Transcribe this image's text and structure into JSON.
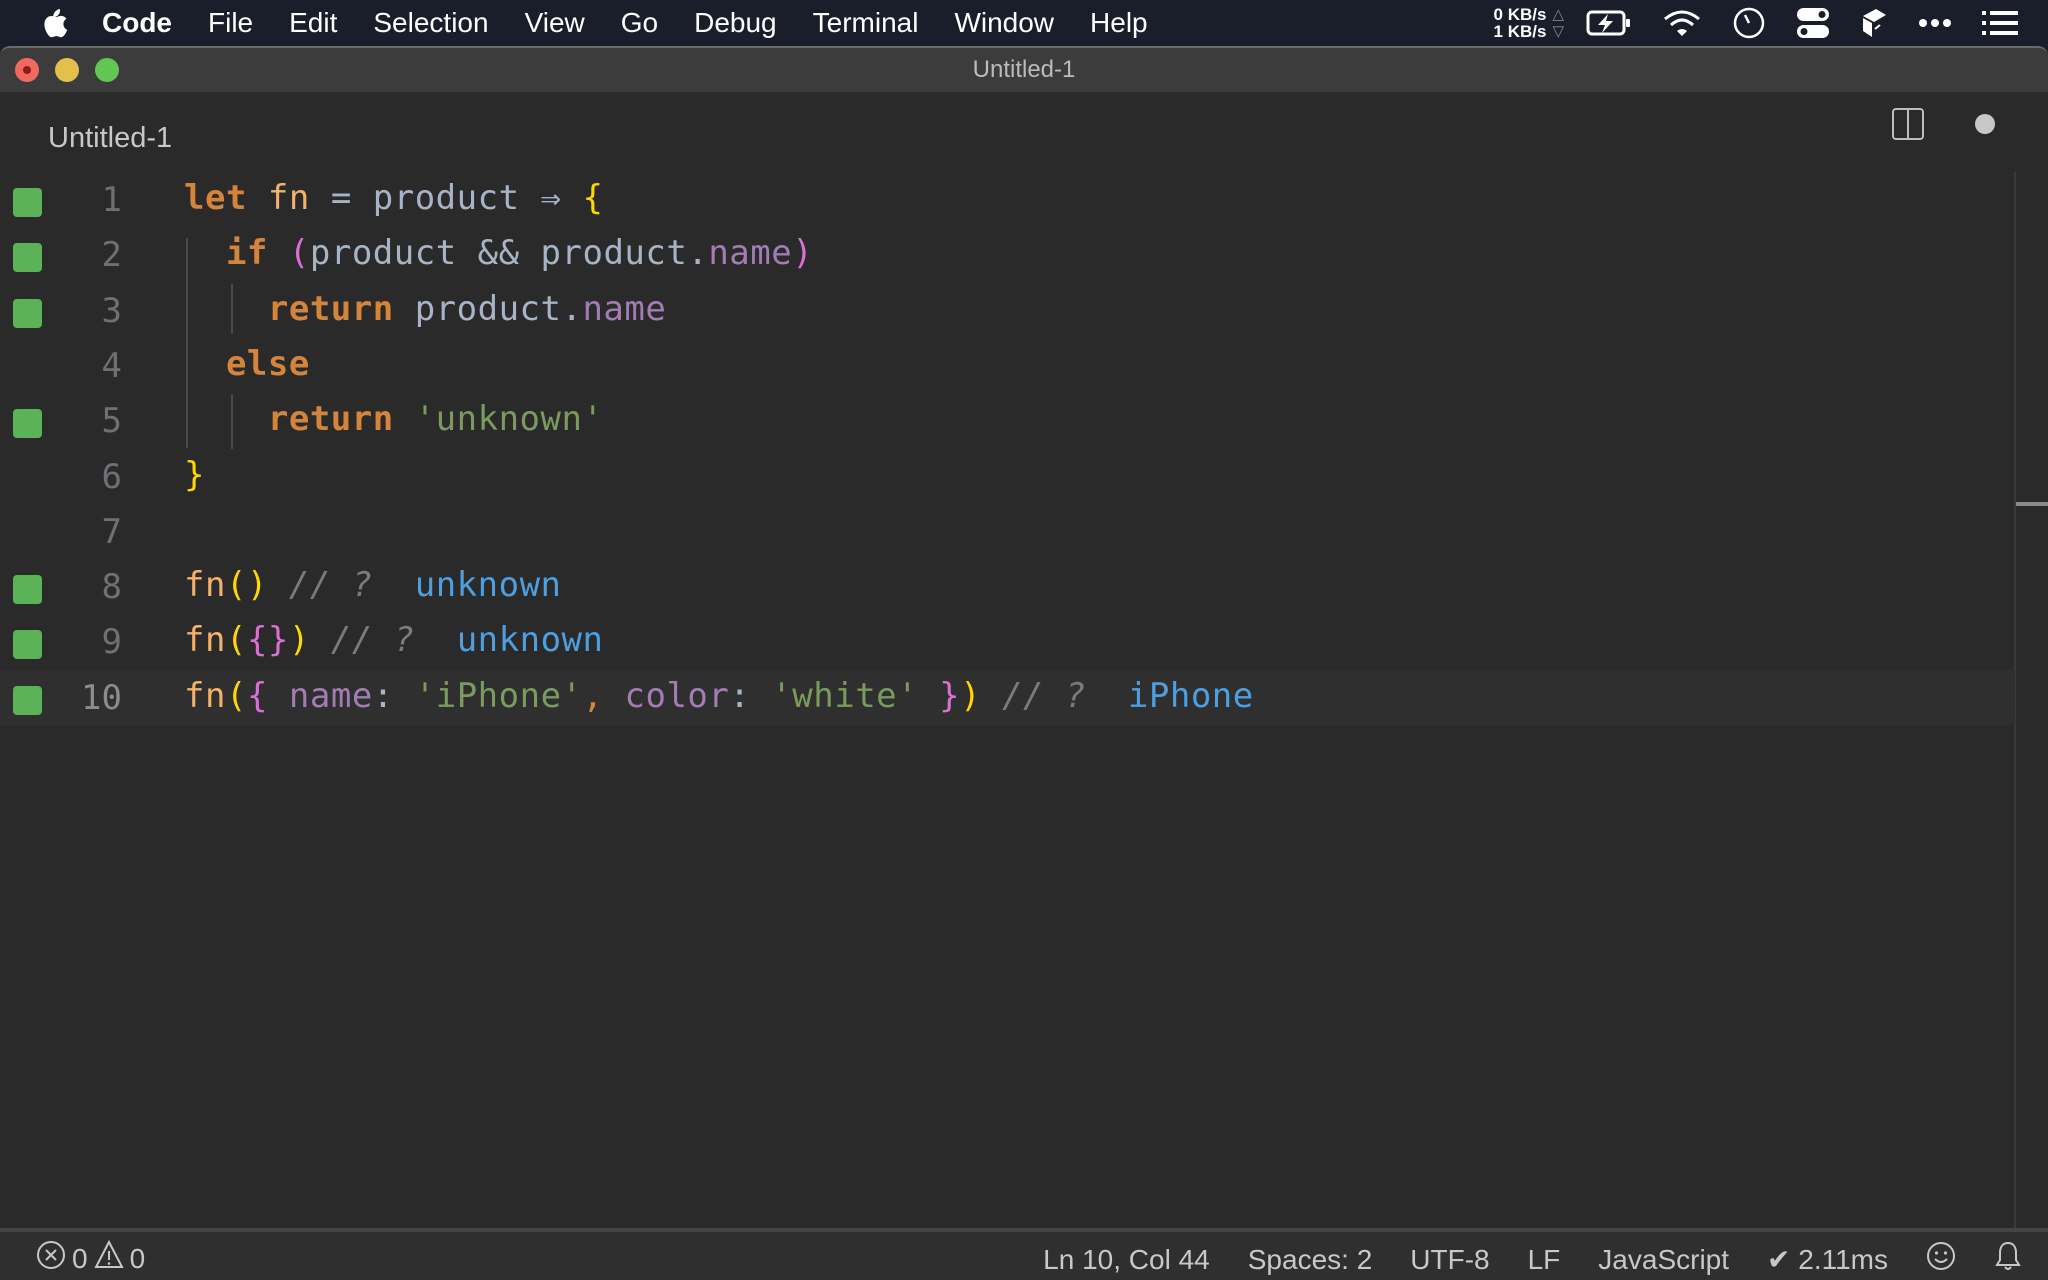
{
  "menubar": {
    "app_name": "Code",
    "items": [
      "File",
      "Edit",
      "Selection",
      "View",
      "Go",
      "Debug",
      "Terminal",
      "Window",
      "Help"
    ],
    "net_up": "0 KB/s",
    "net_down": "1 KB/s",
    "tray_icons": [
      "battery-charging-icon",
      "wifi-icon",
      "clock-icon",
      "control-center-toggles-icon",
      "box-app-icon",
      "more-dots-icon",
      "list-menu-icon"
    ]
  },
  "window": {
    "title": "Untitled-1"
  },
  "tabbar": {
    "active_tab": "Untitled-1",
    "split_editor": "split-editor-icon",
    "unsaved_indicator": "unsaved-dot-icon"
  },
  "editor": {
    "lines": [
      {
        "num": "1",
        "marked": true,
        "tokens": [
          [
            "kw",
            "let"
          ],
          [
            "id",
            " "
          ],
          [
            "fnname",
            "fn"
          ],
          [
            "id",
            " = product ⇒ "
          ],
          [
            "brace-y",
            "{"
          ]
        ]
      },
      {
        "num": "2",
        "marked": true,
        "tokens": [
          [
            "id",
            "  "
          ],
          [
            "kw",
            "if"
          ],
          [
            "id",
            " "
          ],
          [
            "brace-p",
            "("
          ],
          [
            "id",
            "product && product."
          ],
          [
            "prop",
            "name"
          ],
          [
            "brace-p",
            ")"
          ]
        ]
      },
      {
        "num": "3",
        "marked": true,
        "tokens": [
          [
            "id",
            "    "
          ],
          [
            "kw",
            "return"
          ],
          [
            "id",
            " product."
          ],
          [
            "prop",
            "name"
          ]
        ]
      },
      {
        "num": "4",
        "marked": false,
        "tokens": [
          [
            "id",
            "  "
          ],
          [
            "kw",
            "else"
          ]
        ]
      },
      {
        "num": "5",
        "marked": true,
        "tokens": [
          [
            "id",
            "    "
          ],
          [
            "kw",
            "return"
          ],
          [
            "id",
            " "
          ],
          [
            "str",
            "'unknown'"
          ]
        ]
      },
      {
        "num": "6",
        "marked": false,
        "tokens": [
          [
            "brace-y",
            "}"
          ]
        ]
      },
      {
        "num": "7",
        "marked": false,
        "tokens": []
      },
      {
        "num": "8",
        "marked": true,
        "tokens": [
          [
            "fnname",
            "fn"
          ],
          [
            "brace-y",
            "()"
          ],
          [
            "id",
            " "
          ],
          [
            "cmt",
            "// ?"
          ],
          [
            "id",
            "  "
          ],
          [
            "result",
            "unknown"
          ]
        ]
      },
      {
        "num": "9",
        "marked": true,
        "tokens": [
          [
            "fnname",
            "fn"
          ],
          [
            "brace-y",
            "("
          ],
          [
            "brace-p",
            "{}"
          ],
          [
            "brace-y",
            ")"
          ],
          [
            "id",
            " "
          ],
          [
            "cmt",
            "// ?"
          ],
          [
            "id",
            "  "
          ],
          [
            "result",
            "unknown"
          ]
        ]
      },
      {
        "num": "10",
        "marked": true,
        "current": true,
        "tokens": [
          [
            "fnname",
            "fn"
          ],
          [
            "brace-y",
            "("
          ],
          [
            "brace-p",
            "{"
          ],
          [
            "id",
            " "
          ],
          [
            "prop",
            "name"
          ],
          [
            "punct",
            ":"
          ],
          [
            "id",
            " "
          ],
          [
            "str",
            "'iPhone'"
          ],
          [
            "comma",
            ","
          ],
          [
            "id",
            " "
          ],
          [
            "prop",
            "color"
          ],
          [
            "punct",
            ":"
          ],
          [
            "id",
            " "
          ],
          [
            "str",
            "'white'"
          ],
          [
            "id",
            " "
          ],
          [
            "brace-p",
            "}"
          ],
          [
            "brace-y",
            ")"
          ],
          [
            "id",
            " "
          ],
          [
            "cmt",
            "// ?"
          ],
          [
            "id",
            "  "
          ],
          [
            "result",
            "iPhone"
          ]
        ]
      }
    ]
  },
  "statusbar": {
    "errors": "0",
    "warnings": "0",
    "position": "Ln 10, Col 44",
    "indent": "Spaces: 2",
    "encoding": "UTF-8",
    "eol": "LF",
    "language": "JavaScript",
    "timing": "✔ 2.11ms"
  },
  "colors": {
    "gutter_marker": "#5bb257",
    "keyword": "#d5843b",
    "string": "#7a9a5e",
    "result": "#4f9ede",
    "property": "#a27db4"
  }
}
